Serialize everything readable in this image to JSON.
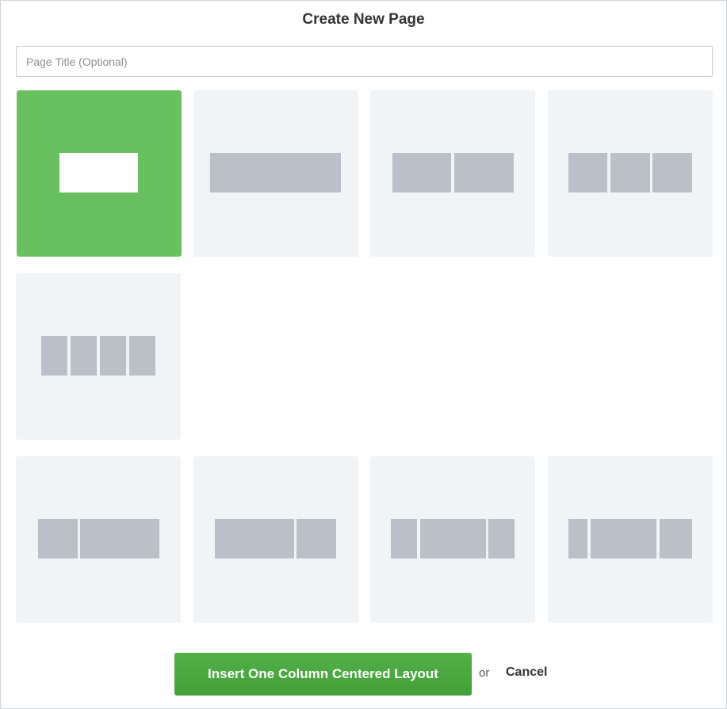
{
  "dialog": {
    "title": "Create New Page",
    "page_title_placeholder": "Page Title (Optional)",
    "page_title_value": ""
  },
  "layouts": [
    {
      "name": "one-column-centered",
      "selected": true
    },
    {
      "name": "one-column-full",
      "selected": false
    },
    {
      "name": "two-columns",
      "selected": false
    },
    {
      "name": "three-columns",
      "selected": false
    },
    {
      "name": "four-columns",
      "selected": false
    },
    {
      "name": "left-sidebar",
      "selected": false
    },
    {
      "name": "right-sidebar",
      "selected": false
    },
    {
      "name": "centered-wide-column",
      "selected": false
    },
    {
      "name": "narrow-left-wide-center",
      "selected": false
    }
  ],
  "colors": {
    "selected": "#68c05e",
    "tile": "#f0f4f7",
    "block": "#b9c0c7",
    "button": "#4aa640"
  },
  "actions": {
    "insert_label": "Insert One Column Centered Layout",
    "or_label": "or",
    "cancel_label": "Cancel"
  }
}
